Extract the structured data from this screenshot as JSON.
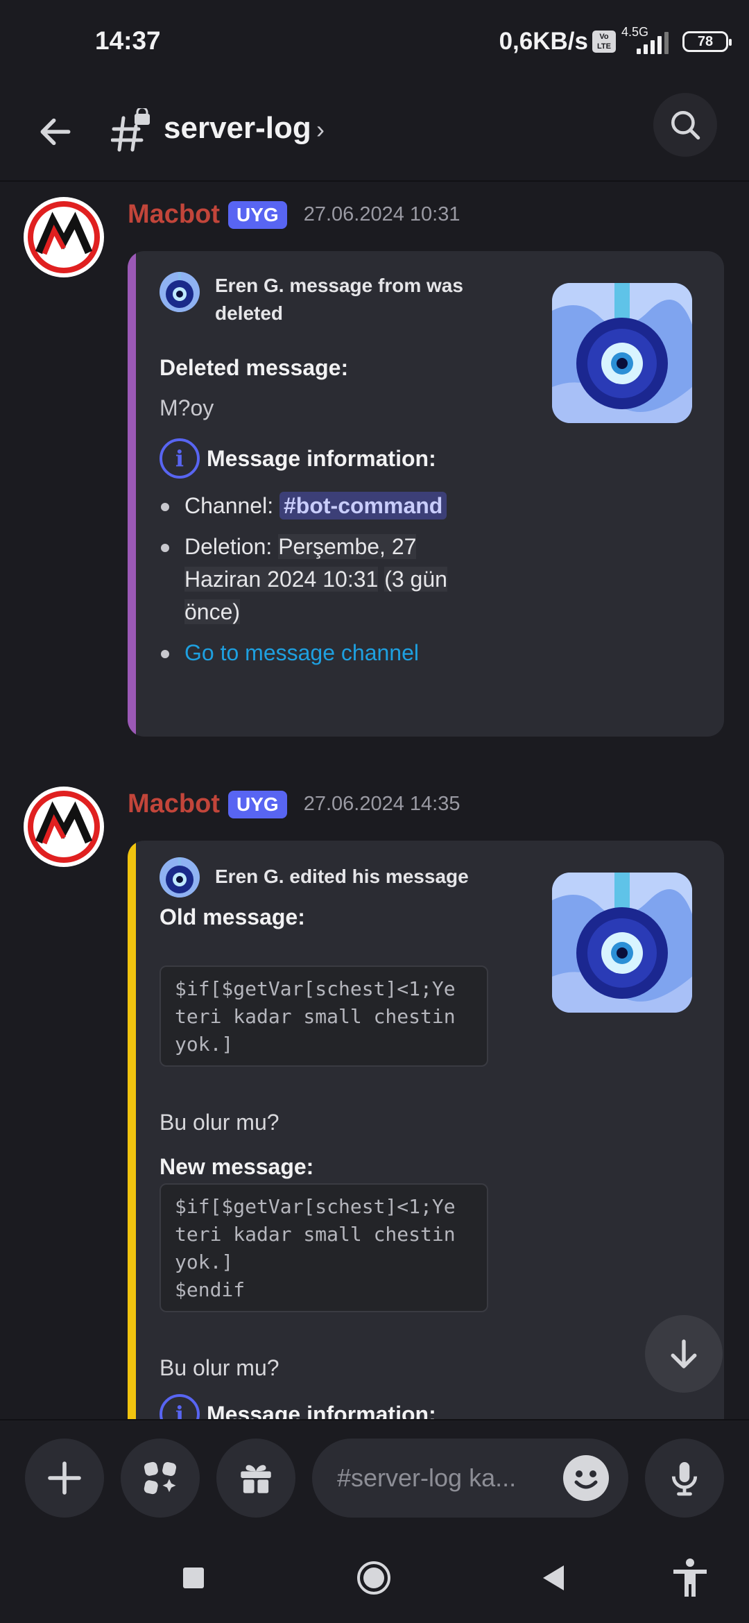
{
  "status_bar": {
    "time": "14:37",
    "net_speed": "0,6KB/s",
    "volte": "Vo\nLTE",
    "network_type": "4.5G",
    "battery": "78"
  },
  "header": {
    "channel_name": "server-log",
    "chevron": "›",
    "back_icon": "arrow-left-icon",
    "search_icon": "search-icon"
  },
  "messages": [
    {
      "author": "Macbot",
      "badge": "UYG",
      "timestamp": "27.06.2024 10:31",
      "embed": {
        "color": "#9b59b6",
        "author_text": "Eren G. message from was deleted",
        "fields": {
          "deleted_title": "Deleted message:",
          "deleted_value": "M?oy",
          "info_title": "Message information:",
          "channel_label": "Channel:",
          "channel_mention": "#bot-command",
          "deletion_label": "Deletion:",
          "deletion_value": "Perşembe, 27 Haziran 2024 10:31",
          "deletion_relative": "(3 gün önce)",
          "link": "Go to message channel"
        }
      }
    },
    {
      "author": "Macbot",
      "badge": "UYG",
      "timestamp": "27.06.2024 14:35",
      "embed": {
        "color": "#f1c40f",
        "author_text": "Eren G. edited his message",
        "fields": {
          "old_title": "Old message:",
          "old_code": "$if[$getVar[schest]<1;Ye\nteri kadar small chestin\nyok.]",
          "old_after": "Bu olur mu?",
          "new_title": "New message:",
          "new_code": "$if[$getVar[schest]<1;Ye\nteri kadar small chestin\nyok.]\n$endif",
          "new_after": "Bu olur mu?",
          "info_title": "Message information:"
        }
      }
    }
  ],
  "composer": {
    "placeholder": "#server-log ka...",
    "buttons": [
      "plus-icon",
      "apps-icon",
      "gift-icon",
      "emoji-icon",
      "microphone-icon"
    ]
  },
  "navbar": {
    "items": [
      "recents-icon",
      "home-icon",
      "back-icon",
      "accessibility-icon"
    ]
  }
}
